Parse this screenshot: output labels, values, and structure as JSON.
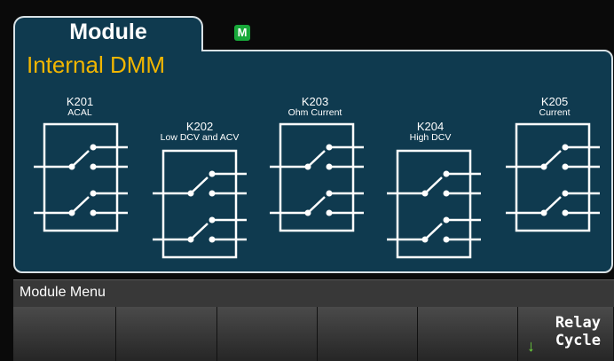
{
  "tab": {
    "label": "Module",
    "status_badge": "M"
  },
  "panel": {
    "title": "Internal DMM"
  },
  "relays": [
    {
      "id": "K201",
      "desc": "ACAL"
    },
    {
      "id": "K202",
      "desc": "Low DCV and ACV"
    },
    {
      "id": "K203",
      "desc": "Ohm Current"
    },
    {
      "id": "K204",
      "desc": "High DCV"
    },
    {
      "id": "K205",
      "desc": "Current"
    }
  ],
  "menu": {
    "label": "Module Menu"
  },
  "softkeys": {
    "relay_cycle_line1": "Relay",
    "relay_cycle_line2": "Cycle",
    "arrow_icon": "down-arrow-icon"
  },
  "colors": {
    "panel": "#0f3a4f",
    "title": "#f2b600",
    "badge": "#18a83a",
    "arrow": "#6fdc3d"
  }
}
